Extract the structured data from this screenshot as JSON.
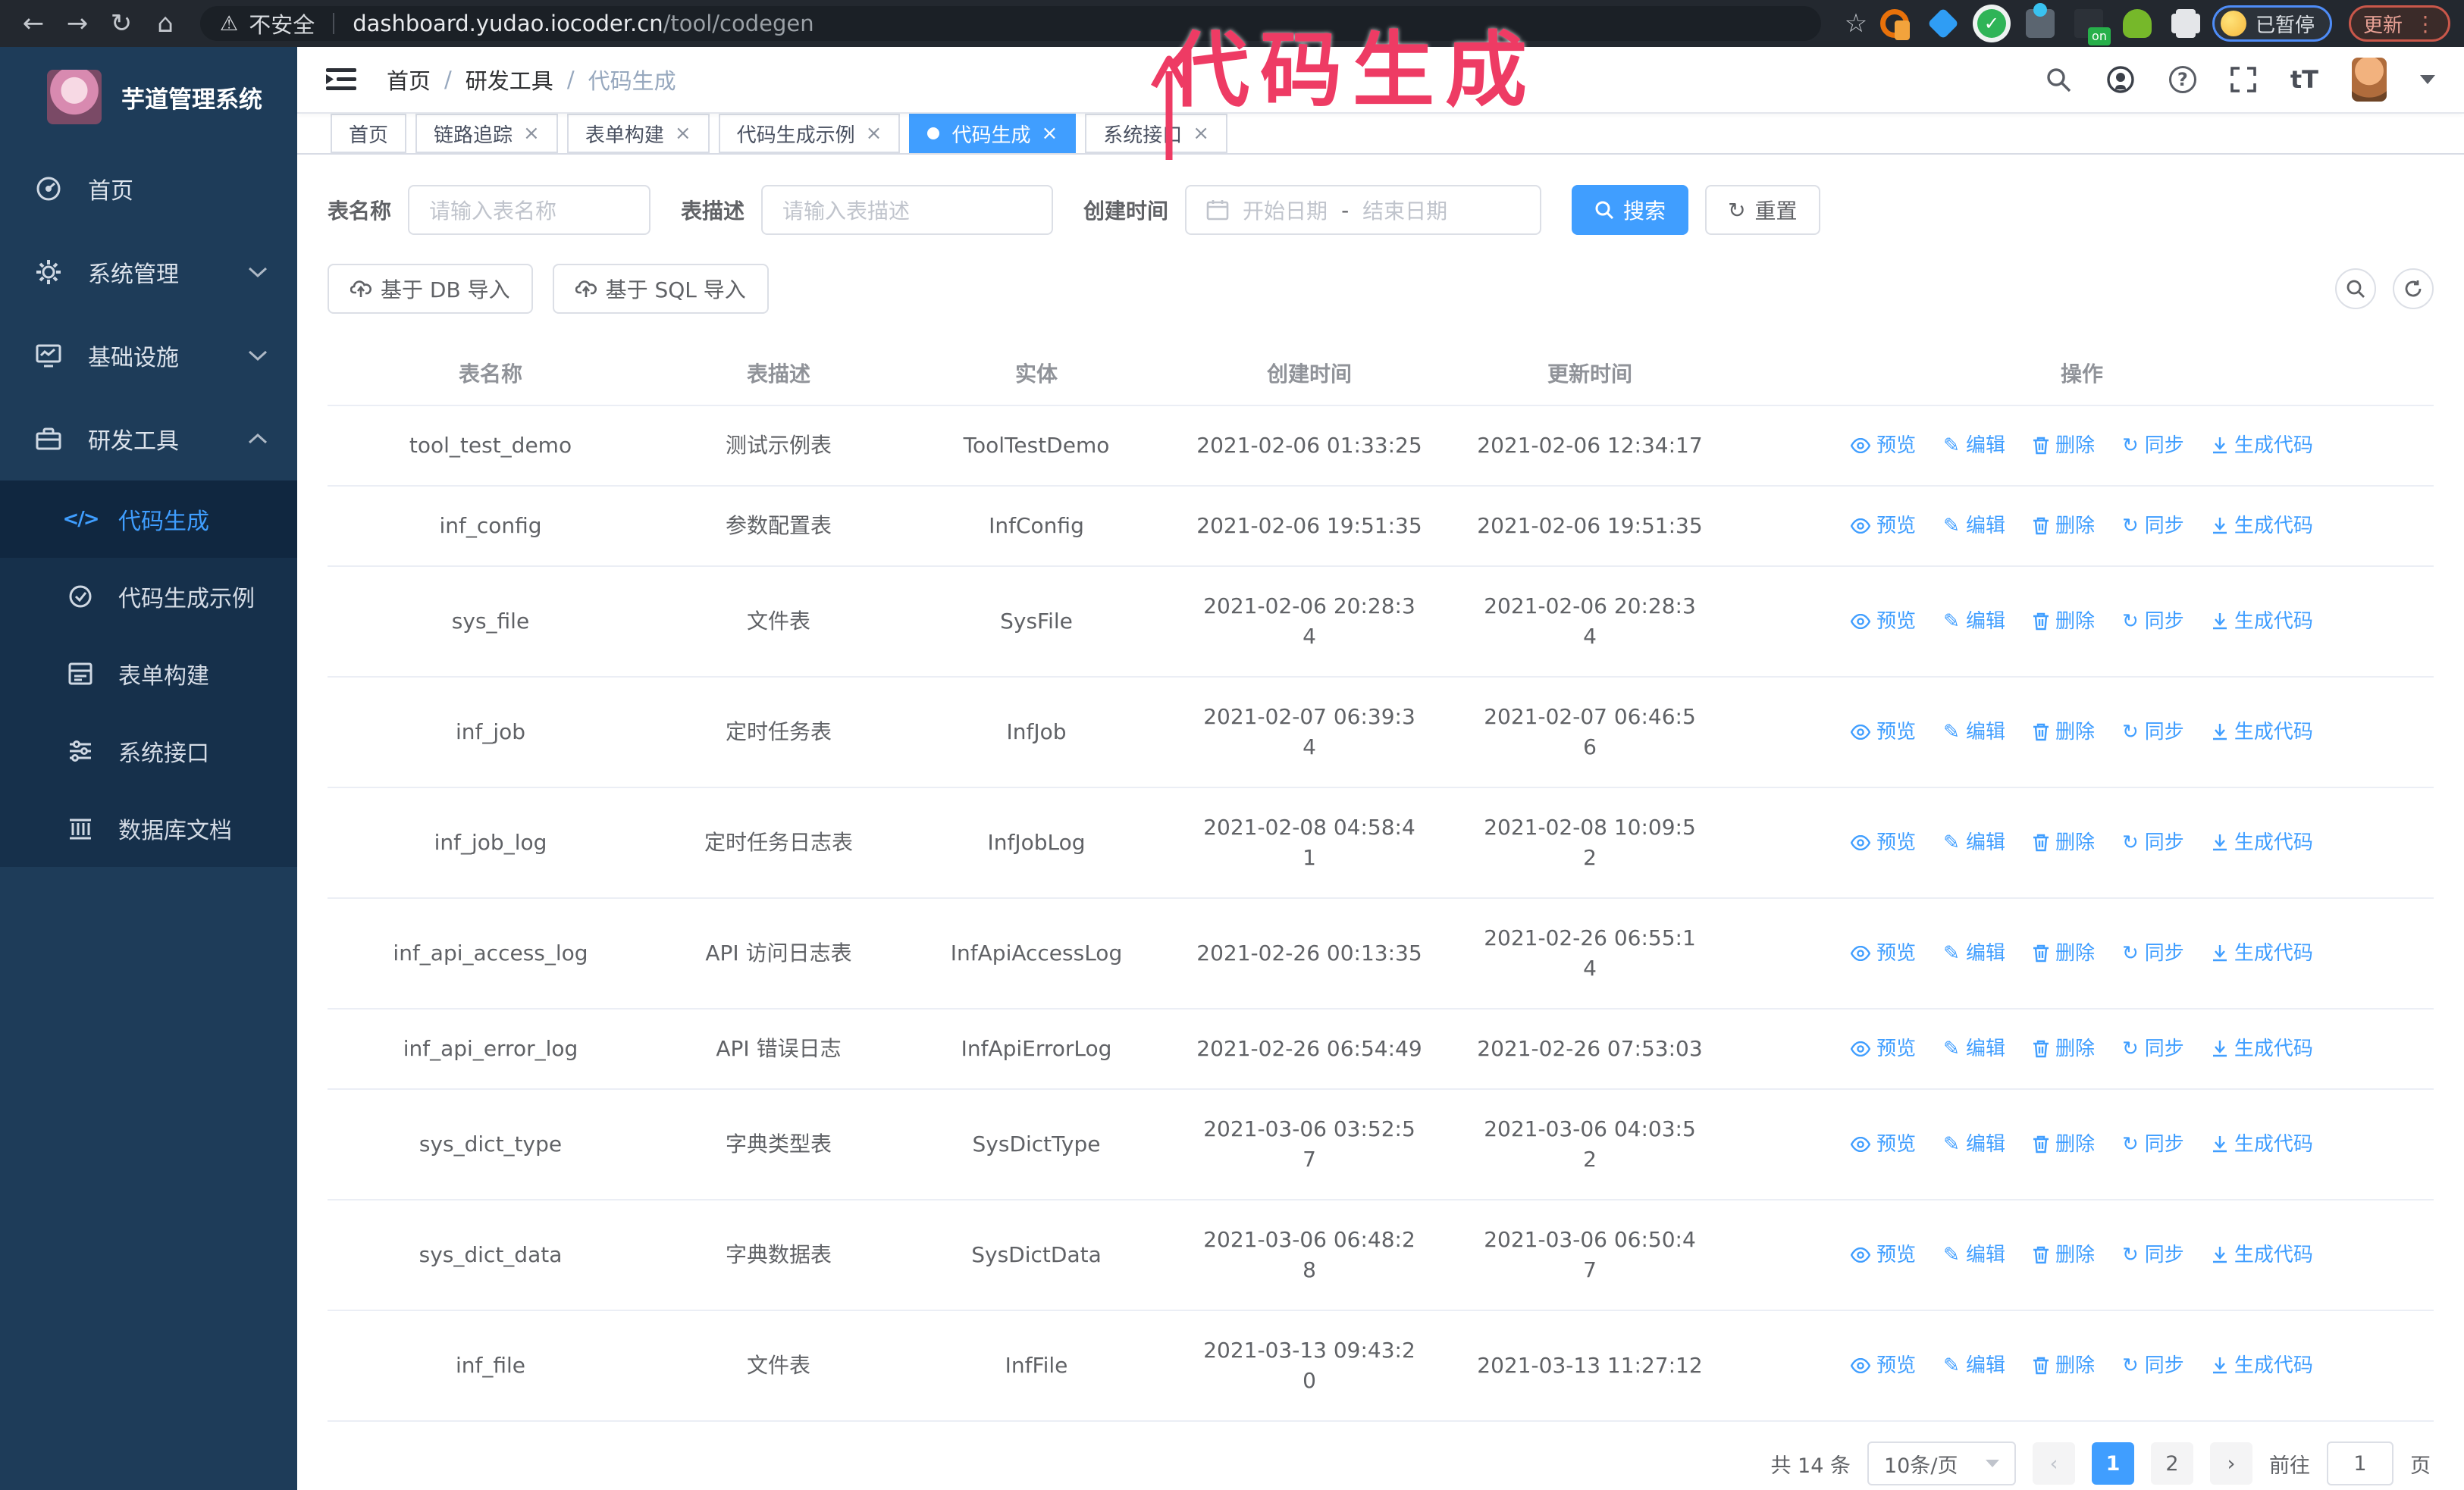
{
  "browser": {
    "security_label": "不安全",
    "url_host": "dashboard.yudao.iocoder.cn",
    "url_path": "/tool/codegen",
    "profile_status": "已暂停",
    "update_label": "更新"
  },
  "annotation": {
    "text": "代码生成",
    "color": "#ee3b64"
  },
  "icons": {
    "back": "←",
    "forward": "→",
    "reload": "↻",
    "home": "⌂",
    "warning": "⚠",
    "star": "☆",
    "kebab": "⋮",
    "close": "×",
    "slash": "/",
    "font_size": "tT",
    "help": "?",
    "refresh": "↻",
    "pencil": "✎",
    "code": "</>",
    "dash": "-"
  },
  "sidebar": {
    "app_title": "芋道管理系统",
    "items": [
      {
        "label": "首页"
      },
      {
        "label": "系统管理"
      },
      {
        "label": "基础设施"
      },
      {
        "label": "研发工具"
      }
    ],
    "submenu": [
      {
        "label": "代码生成"
      },
      {
        "label": "代码生成示例"
      },
      {
        "label": "表单构建"
      },
      {
        "label": "系统接口"
      },
      {
        "label": "数据库文档"
      }
    ]
  },
  "header": {
    "breadcrumb": [
      "首页",
      "研发工具",
      "代码生成"
    ]
  },
  "tabs": [
    {
      "label": "首页"
    },
    {
      "label": "链路追踪"
    },
    {
      "label": "表单构建"
    },
    {
      "label": "代码生成示例"
    },
    {
      "label": "代码生成"
    },
    {
      "label": "系统接口"
    }
  ],
  "filters": {
    "name_label": "表名称",
    "name_placeholder": "请输入表名称",
    "desc_label": "表描述",
    "desc_placeholder": "请输入表描述",
    "time_label": "创建时间",
    "start_placeholder": "开始日期",
    "end_placeholder": "结束日期",
    "search_label": "搜索",
    "reset_label": "重置"
  },
  "toolbar": {
    "import_db_label": "基于 DB 导入",
    "import_sql_label": "基于 SQL 导入"
  },
  "table": {
    "columns": [
      "表名称",
      "表描述",
      "实体",
      "创建时间",
      "更新时间",
      "操作"
    ],
    "actions": [
      "预览",
      "编辑",
      "删除",
      "同步",
      "生成代码"
    ],
    "rows": [
      {
        "name": "tool_test_demo",
        "desc": "测试示例表",
        "entity": "ToolTestDemo",
        "created": "2021-02-06 01:33:25",
        "updated": "2021-02-06 12:34:17",
        "cw": false,
        "uw": false
      },
      {
        "name": "inf_config",
        "desc": "参数配置表",
        "entity": "InfConfig",
        "created": "2021-02-06 19:51:35",
        "updated": "2021-02-06 19:51:35",
        "cw": false,
        "uw": false
      },
      {
        "name": "sys_file",
        "desc": "文件表",
        "entity": "SysFile",
        "created": "2021-02-06 20:28:34",
        "updated": "2021-02-06 20:28:34",
        "cw": true,
        "uw": true
      },
      {
        "name": "inf_job",
        "desc": "定时任务表",
        "entity": "InfJob",
        "created": "2021-02-07 06:39:34",
        "updated": "2021-02-07 06:46:56",
        "cw": true,
        "uw": true
      },
      {
        "name": "inf_job_log",
        "desc": "定时任务日志表",
        "entity": "InfJobLog",
        "created": "2021-02-08 04:58:41",
        "updated": "2021-02-08 10:09:52",
        "cw": true,
        "uw": true
      },
      {
        "name": "inf_api_access_log",
        "desc": "API 访问日志表",
        "entity": "InfApiAccessLog",
        "created": "2021-02-26 00:13:35",
        "updated": "2021-02-26 06:55:14",
        "cw": false,
        "uw": true
      },
      {
        "name": "inf_api_error_log",
        "desc": "API 错误日志",
        "entity": "InfApiErrorLog",
        "created": "2021-02-26 06:54:49",
        "updated": "2021-02-26 07:53:03",
        "cw": false,
        "uw": false
      },
      {
        "name": "sys_dict_type",
        "desc": "字典类型表",
        "entity": "SysDictType",
        "created": "2021-03-06 03:52:57",
        "updated": "2021-03-06 04:03:52",
        "cw": true,
        "uw": true
      },
      {
        "name": "sys_dict_data",
        "desc": "字典数据表",
        "entity": "SysDictData",
        "created": "2021-03-06 06:48:28",
        "updated": "2021-03-06 06:50:47",
        "cw": true,
        "uw": true
      },
      {
        "name": "inf_file",
        "desc": "文件表",
        "entity": "InfFile",
        "created": "2021-03-13 09:43:20",
        "updated": "2021-03-13 11:27:12",
        "cw": true,
        "uw": false
      }
    ]
  },
  "pagination": {
    "total_label": "共 14 条",
    "page_size": "10条/页",
    "prev": "‹",
    "next": "›",
    "page1": "1",
    "page2": "2",
    "goto_label": "前往",
    "goto_value": "1",
    "page_unit": "页"
  }
}
